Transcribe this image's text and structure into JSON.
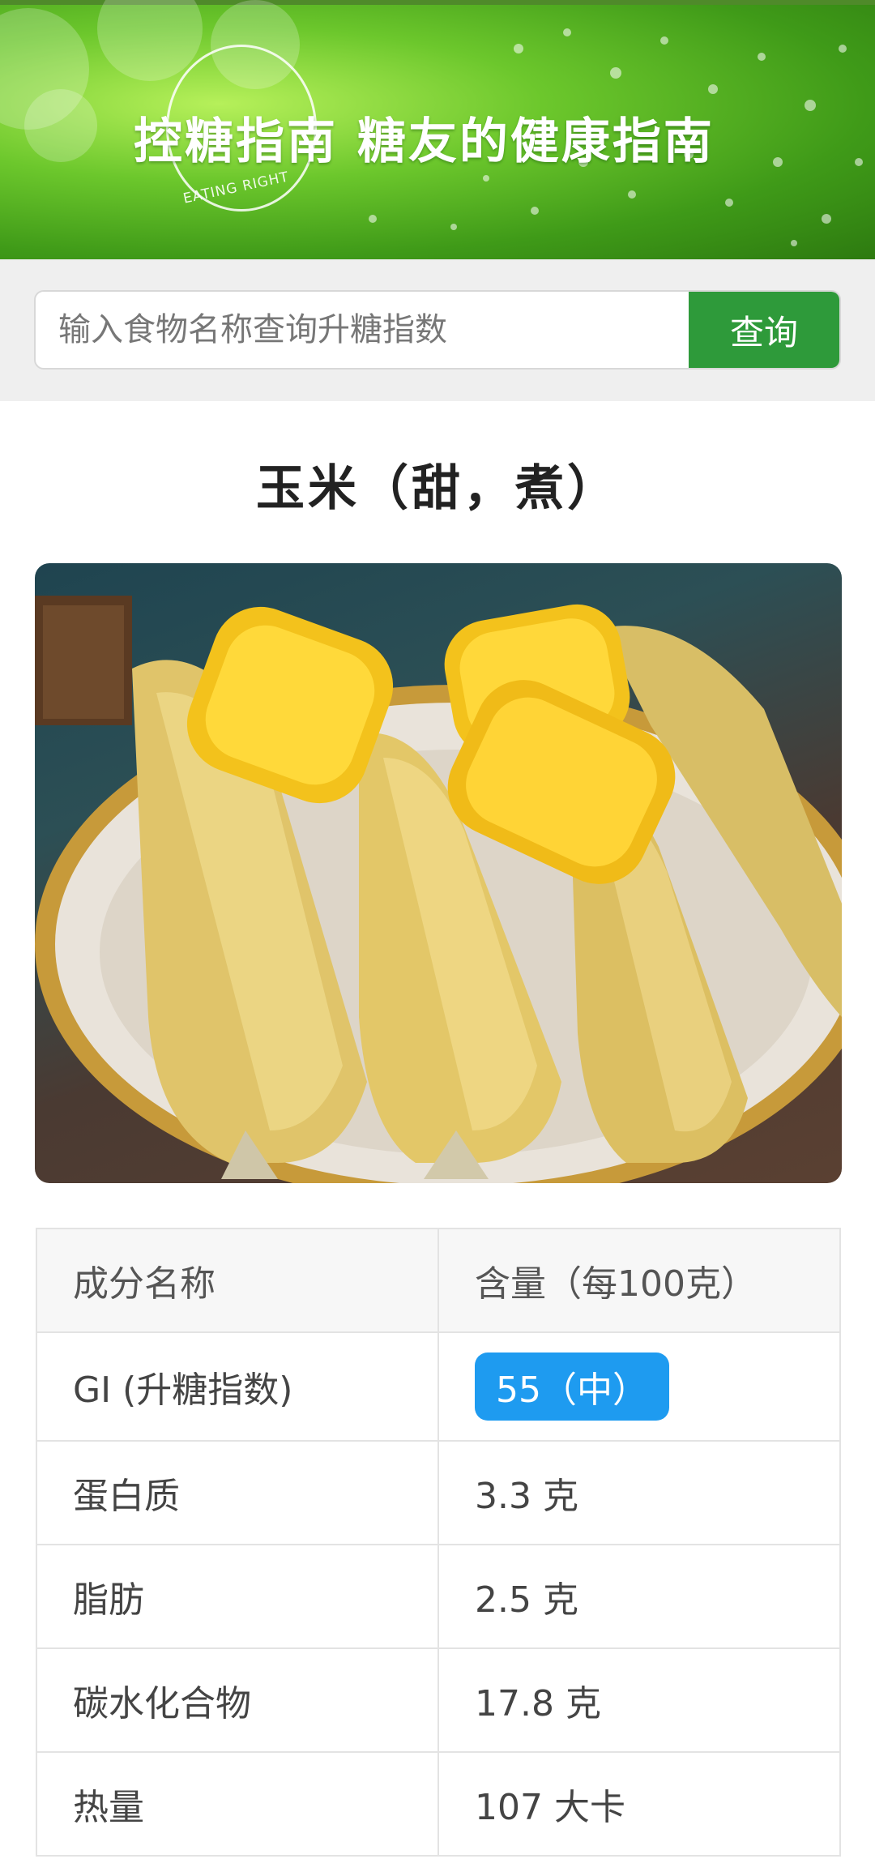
{
  "banner": {
    "title": "控糖指南  糖友的健康指南",
    "emblem_text": "EATING RIGHT"
  },
  "search": {
    "placeholder": "输入食物名称查询升糖指数",
    "value": "",
    "button_label": "查询"
  },
  "food": {
    "title": "玉米（甜，煮）"
  },
  "nutrition": {
    "headers": [
      "成分名称",
      "含量（每100克）"
    ],
    "rows": [
      {
        "name": "GI (升糖指数)",
        "value": "55（中）",
        "badge": true
      },
      {
        "name": "蛋白质",
        "value": "3.3 克"
      },
      {
        "name": "脂肪",
        "value": "2.5 克"
      },
      {
        "name": "碳水化合物",
        "value": "17.8 克"
      },
      {
        "name": "热量",
        "value": "107 大卡"
      }
    ]
  },
  "colors": {
    "search_button": "#2e9a3a",
    "gi_badge": "#1e9bf0"
  }
}
